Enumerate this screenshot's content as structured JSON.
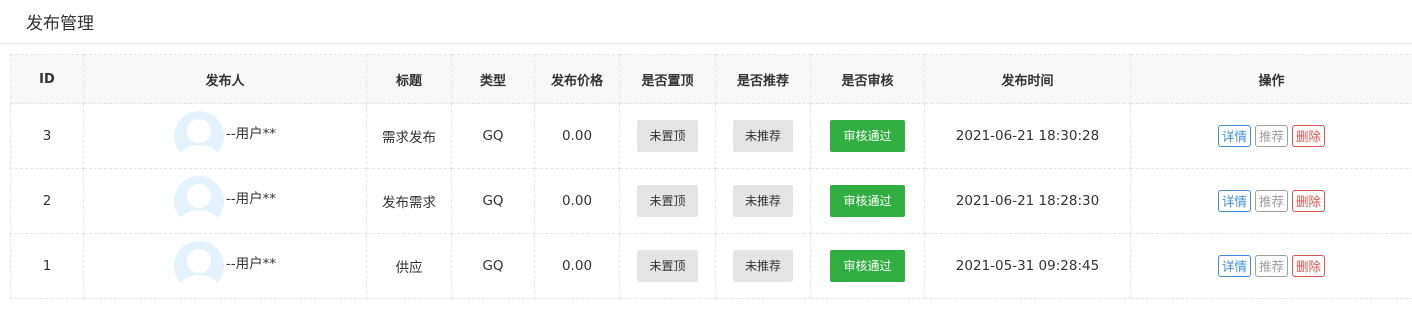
{
  "header": {
    "title": "发布管理"
  },
  "table": {
    "columns": [
      "ID",
      "发布人",
      "标题",
      "类型",
      "发布价格",
      "是否置顶",
      "是否推荐",
      "是否审核",
      "发布时间",
      "操作"
    ],
    "rows": [
      {
        "id": "3",
        "publisher": "--用户**",
        "title": "需求发布",
        "type": "GQ",
        "price": "0.00",
        "top": "未置顶",
        "recommend": "未推荐",
        "review": "审核通过",
        "time": "2021-06-21 18:30:28",
        "ops": {
          "detail": "详情",
          "recommend": "推荐",
          "delete": "删除"
        }
      },
      {
        "id": "2",
        "publisher": "--用户**",
        "title": "发布需求",
        "type": "GQ",
        "price": "0.00",
        "top": "未置顶",
        "recommend": "未推荐",
        "review": "审核通过",
        "time": "2021-06-21 18:28:30",
        "ops": {
          "detail": "详情",
          "recommend": "推荐",
          "delete": "删除"
        }
      },
      {
        "id": "1",
        "publisher": "--用户**",
        "title": "供应",
        "type": "GQ",
        "price": "0.00",
        "top": "未置顶",
        "recommend": "未推荐",
        "review": "审核通过",
        "time": "2021-05-31 09:28:45",
        "ops": {
          "detail": "详情",
          "recommend": "推荐",
          "delete": "删除"
        }
      }
    ]
  },
  "colors": {
    "approved_green": "#31ae42",
    "status_grey": "#e4e4e4",
    "detail_blue": "#3a8ed9",
    "delete_red": "#d9534f",
    "recommend_grey": "#9e9e9e",
    "avatar_bg": "#e4f2fc"
  },
  "icons": {
    "avatar": "user-avatar-icon"
  }
}
